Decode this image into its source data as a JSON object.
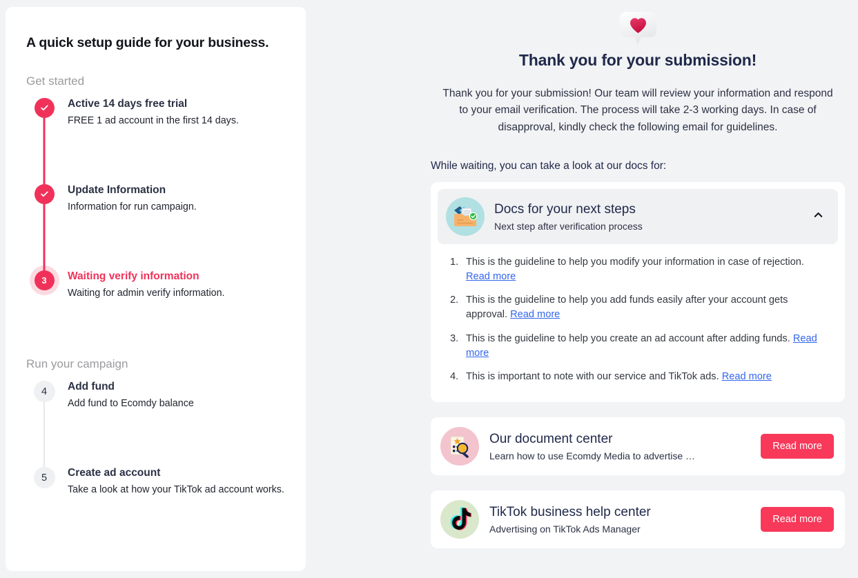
{
  "colors": {
    "page_bg": "#f2f3f5",
    "accent_pink": "#f0325a",
    "button_pink": "#f8395a",
    "heading_navy": "#20294a",
    "link_blue": "#3366ee",
    "muted_grey": "#9b9b9f"
  },
  "sidebar": {
    "title": "A quick setup guide for your business.",
    "sections": [
      {
        "label": "Get started",
        "steps": [
          {
            "marker": "check",
            "number": "1",
            "state": "done",
            "title": "Active 14 days free trial",
            "desc": "FREE 1 ad account in the first 14 days."
          },
          {
            "marker": "check",
            "number": "2",
            "state": "done",
            "title": "Update Information",
            "desc": "Information for run campaign."
          },
          {
            "marker": "number",
            "number": "3",
            "state": "current",
            "title": "Waiting verify information",
            "desc": "Waiting for admin verify information."
          }
        ]
      },
      {
        "label": "Run your campaign",
        "steps": [
          {
            "marker": "number",
            "number": "4",
            "state": "pending",
            "title": "Add fund",
            "desc": "Add fund to Ecomdy balance"
          },
          {
            "marker": "number",
            "number": "5",
            "state": "pending",
            "title": "Create ad account",
            "desc": "Take a look at how your TikTok ad account works."
          }
        ]
      }
    ]
  },
  "hero": {
    "icon": "heart-speech-bubble-icon",
    "title": "Thank you for your submission!",
    "body": "Thank you for your submission! Our team will review your information and respond to your email verification. The process will take 2-3 working days. In case of disapproval, kindly check the following email for guidelines."
  },
  "docs_intro": "While waiting, you can take a look at our docs for:",
  "docs_card": {
    "icon": "documents-folder-icon",
    "title": "Docs for your next steps",
    "subtitle": "Next step after verification process",
    "toggle_icon": "chevron-up-icon",
    "expanded": true,
    "items": [
      {
        "text": "This is the guideline to help you modify your information in case of rejection.",
        "link": "Read more"
      },
      {
        "text": "This is the guideline to help you add funds easily after your account gets approval.",
        "link": "Read more"
      },
      {
        "text": "This is the guideline to help you create an ad account after adding funds.",
        "link": "Read more"
      },
      {
        "text": "This is important to note with our service and TikTok ads.",
        "link": "Read more"
      }
    ]
  },
  "promos": [
    {
      "icon": "document-search-icon",
      "title": "Our document center",
      "subtitle": "Learn how to use Ecomdy Media to advertise …",
      "button": "Read more"
    },
    {
      "icon": "tiktok-logo-icon",
      "title": "TikTok business help center",
      "subtitle": "Advertising on TikTok Ads Manager",
      "button": "Read more"
    }
  ]
}
